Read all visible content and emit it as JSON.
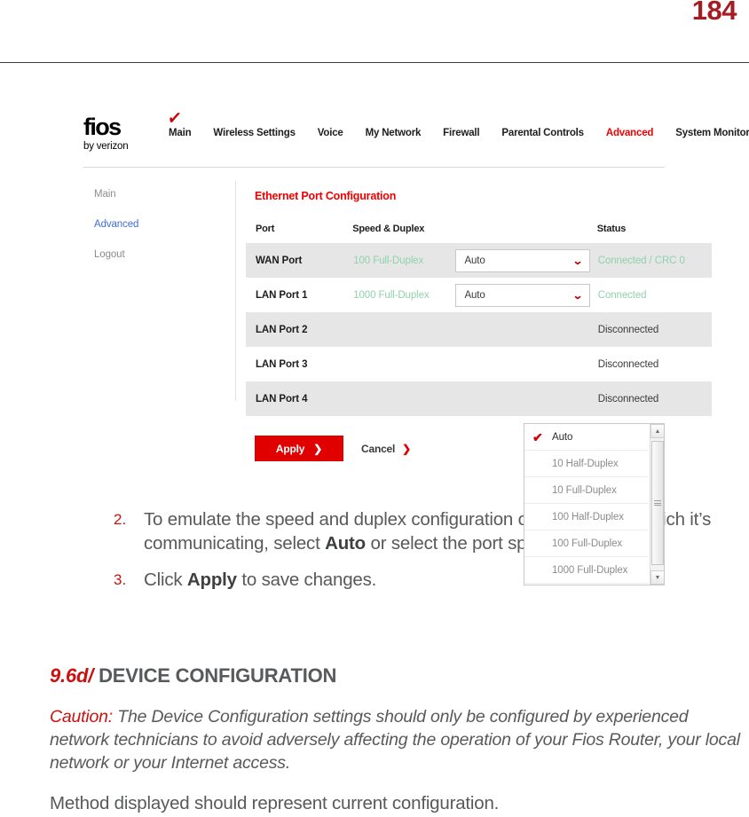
{
  "page": {
    "number": "184"
  },
  "screenshot": {
    "logo": {
      "word": "fios",
      "check": "✓",
      "sub": "by verizon"
    },
    "nav": [
      {
        "label": "Main",
        "active": false
      },
      {
        "label": "Wireless Settings",
        "active": false
      },
      {
        "label": "Voice",
        "active": false
      },
      {
        "label": "My Network",
        "active": false
      },
      {
        "label": "Firewall",
        "active": false
      },
      {
        "label": "Parental Controls",
        "active": false
      },
      {
        "label": "Advanced",
        "active": true
      },
      {
        "label": "System Monitoring",
        "active": false
      }
    ],
    "sidebar": [
      {
        "label": "Main",
        "active": false
      },
      {
        "label": "Advanced",
        "active": true
      },
      {
        "label": "Logout",
        "active": false
      }
    ],
    "panel": {
      "title": "Ethernet Port Configuration",
      "columns": {
        "port": "Port",
        "speed": "Speed & Duplex",
        "select": "",
        "status": "Status"
      },
      "rows": [
        {
          "port": "WAN Port",
          "speed": "100 Full-Duplex",
          "select": "Auto",
          "status": "Connected / CRC 0",
          "status_ok": true,
          "has_select": true
        },
        {
          "port": "LAN Port 1",
          "speed": "1000 Full-Duplex",
          "select": "Auto",
          "status": "Connected",
          "status_ok": true,
          "has_select": true
        },
        {
          "port": "LAN Port 2",
          "speed": "",
          "select": "",
          "status": "Disconnected",
          "status_ok": false,
          "has_select": false
        },
        {
          "port": "LAN Port 3",
          "speed": "",
          "select": "",
          "status": "Disconnected",
          "status_ok": false,
          "has_select": false
        },
        {
          "port": "LAN Port 4",
          "speed": "",
          "select": "",
          "status": "Disconnected",
          "status_ok": false,
          "has_select": false
        }
      ],
      "dropdown_options": [
        {
          "label": "Auto",
          "selected": true
        },
        {
          "label": "10 Half-Duplex",
          "selected": false
        },
        {
          "label": "10 Full-Duplex",
          "selected": false
        },
        {
          "label": "100 Half-Duplex",
          "selected": false
        },
        {
          "label": "100 Full-Duplex",
          "selected": false
        },
        {
          "label": "1000 Full-Duplex",
          "selected": false
        }
      ],
      "check_glyph": "✔",
      "chevron_glyph": "⌄",
      "apply_label": "Apply",
      "apply_chevron": "❯",
      "cancel_label": "Cancel",
      "cancel_chevron": "❯"
    }
  },
  "steps": [
    {
      "num": "2.",
      "pre": "To emulate the speed and duplex configuration of the port with which it’s communicating, select ",
      "bold": "Auto",
      "post": " or select the port speed and duplicity."
    },
    {
      "num": "3.",
      "pre": "Click ",
      "bold": "Apply",
      "post": " to save changes."
    }
  ],
  "section": {
    "number": "9.6d/",
    "title": "DEVICE CONFIGURATION"
  },
  "caution": {
    "lead": "Caution:",
    "body": " The Device Configuration settings should only be configured by experienced network technicians to avoid adversely affecting the operation of your Fios Router, your local network or your Internet access."
  },
  "closing": "Method displayed should represent current configuration."
}
